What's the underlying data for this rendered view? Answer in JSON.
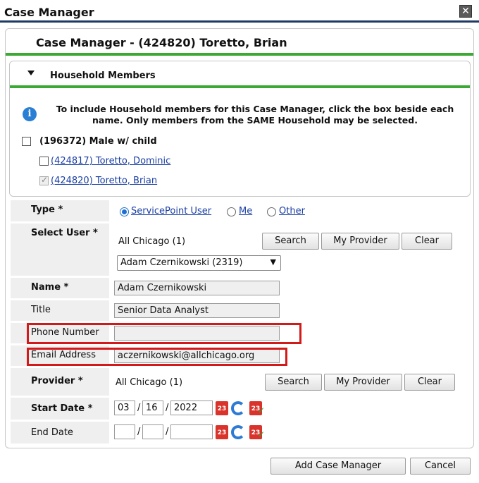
{
  "window": {
    "title": "Case Manager",
    "close_icon": "close-icon"
  },
  "panel": {
    "title": "Case Manager - (424820) Toretto, Brian"
  },
  "household": {
    "header": "Household Members",
    "info": "To include Household members for this Case Manager, click the box beside each name. Only members from the SAME Household may be selected.",
    "group_label": "(196372) Male w/ child",
    "members": [
      {
        "label": "(424817) Toretto, Dominic",
        "checked": false
      },
      {
        "label": "(424820) Toretto, Brian",
        "checked": true
      }
    ]
  },
  "form": {
    "type": {
      "label": "Type",
      "options": [
        "ServicePoint User",
        "Me",
        "Other"
      ],
      "selected": "ServicePoint User"
    },
    "select_user": {
      "label": "Select User",
      "provider_text": "All Chicago (1)",
      "selected_user": "Adam Czernikowski (2319)",
      "search_button": "Search",
      "my_provider_button": "My Provider",
      "clear_button": "Clear"
    },
    "name": {
      "label": "Name",
      "value": "Adam Czernikowski"
    },
    "title": {
      "label": "Title",
      "value": "Senior Data Analyst"
    },
    "phone": {
      "label": "Phone Number",
      "value": ""
    },
    "email": {
      "label": "Email Address",
      "value": "aczernikowski@allchicago.org"
    },
    "provider": {
      "label": "Provider",
      "value": "All Chicago (1)",
      "search_button": "Search",
      "my_provider_button": "My Provider",
      "clear_button": "Clear"
    },
    "start_date": {
      "label": "Start Date",
      "month": "03",
      "day": "16",
      "year": "2022"
    },
    "end_date": {
      "label": "End Date",
      "month": "",
      "day": "",
      "year": ""
    },
    "required_mark": "*"
  },
  "footer": {
    "add_button": "Add Case Manager",
    "cancel_button": "Cancel"
  },
  "colors": {
    "accent_green": "#3aaa35",
    "title_bar": "#1f3a63",
    "highlight_red": "#d31a1a",
    "link_blue": "#1a3fa3"
  }
}
